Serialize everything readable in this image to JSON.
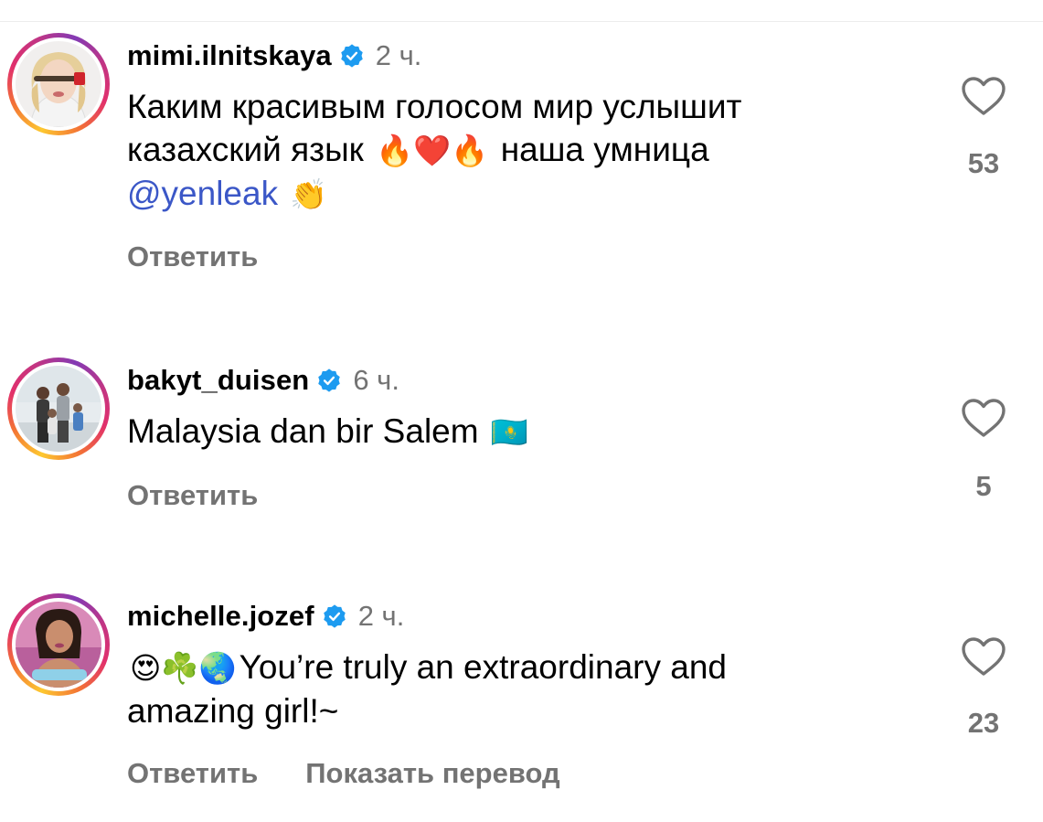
{
  "comments": [
    {
      "username": "mimi.ilnitskaya",
      "time": "2 ч.",
      "text_line1": "Каким красивым голосом мир услышит",
      "text_line2_a": "казахский язык",
      "emoji_a": "🔥❤️🔥",
      "text_line2_b": "наша умница",
      "mention": "@yenleak",
      "emoji_b": "👏",
      "reply_label": "Ответить",
      "likes": "53"
    },
    {
      "username": "bakyt_duisen",
      "time": "6 ч.",
      "text": "Malaysia dan bir Salem",
      "emoji": "🇰🇿",
      "reply_label": "Ответить",
      "likes": "5"
    },
    {
      "username": "michelle.jozef",
      "time": "2 ч.",
      "emoji": "😍☘️🌏",
      "text_line1": "You’re truly an extraordinary and",
      "text_line2": "amazing girl!~",
      "reply_label": "Ответить",
      "translate_label": "Показать перевод",
      "likes": "23"
    }
  ],
  "icons": {
    "verified": "verified-badge-icon",
    "like": "heart-icon",
    "accent_blue": "#1d9bf0",
    "muted_gray": "#737373",
    "mention_blue": "#3b57c7"
  }
}
